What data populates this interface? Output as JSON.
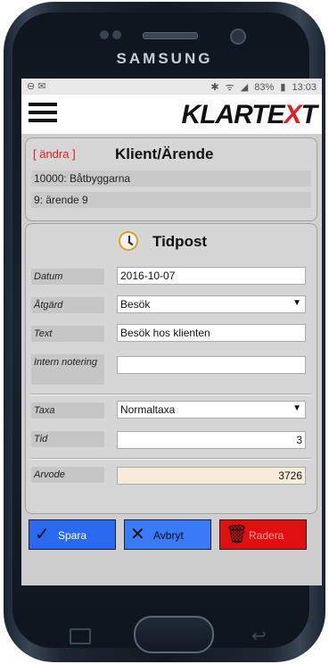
{
  "device": {
    "brand": "SAMSUNG"
  },
  "status_bar": {
    "left_icons": "⊖ ✉",
    "bluetooth": "✱",
    "wifi": "ᯤ",
    "signal": "◢",
    "battery": "83%",
    "battery_icon": "▮",
    "time": "13:03"
  },
  "header": {
    "logo_part1": "KLARTE",
    "logo_x": "X",
    "logo_part2": "T"
  },
  "client_panel": {
    "edit_label": "[ ändra ]",
    "title": "Klient/Ärende",
    "client": "10000: Båtbyggarna",
    "case": "9: ärende 9"
  },
  "time_panel": {
    "title": "Tidpost",
    "fields": {
      "datum": {
        "label": "Datum",
        "value": "2016-10-07"
      },
      "atgard": {
        "label": "Åtgärd",
        "value": "Besök"
      },
      "text": {
        "label": "Text",
        "value": "Besök hos klienten"
      },
      "intern": {
        "label": "Intern notering",
        "value": ""
      },
      "taxa": {
        "label": "Taxa",
        "value": "Normaltaxa"
      },
      "tid": {
        "label": "Tid",
        "value": "3"
      },
      "arvode": {
        "label": "Arvode",
        "value": "3726"
      }
    }
  },
  "buttons": {
    "save": "Spara",
    "cancel": "Avbryt",
    "delete": "Radera"
  },
  "colors": {
    "accent_red": "#e02020",
    "save_blue": "#2a6af0",
    "delete_red": "#e01010"
  }
}
